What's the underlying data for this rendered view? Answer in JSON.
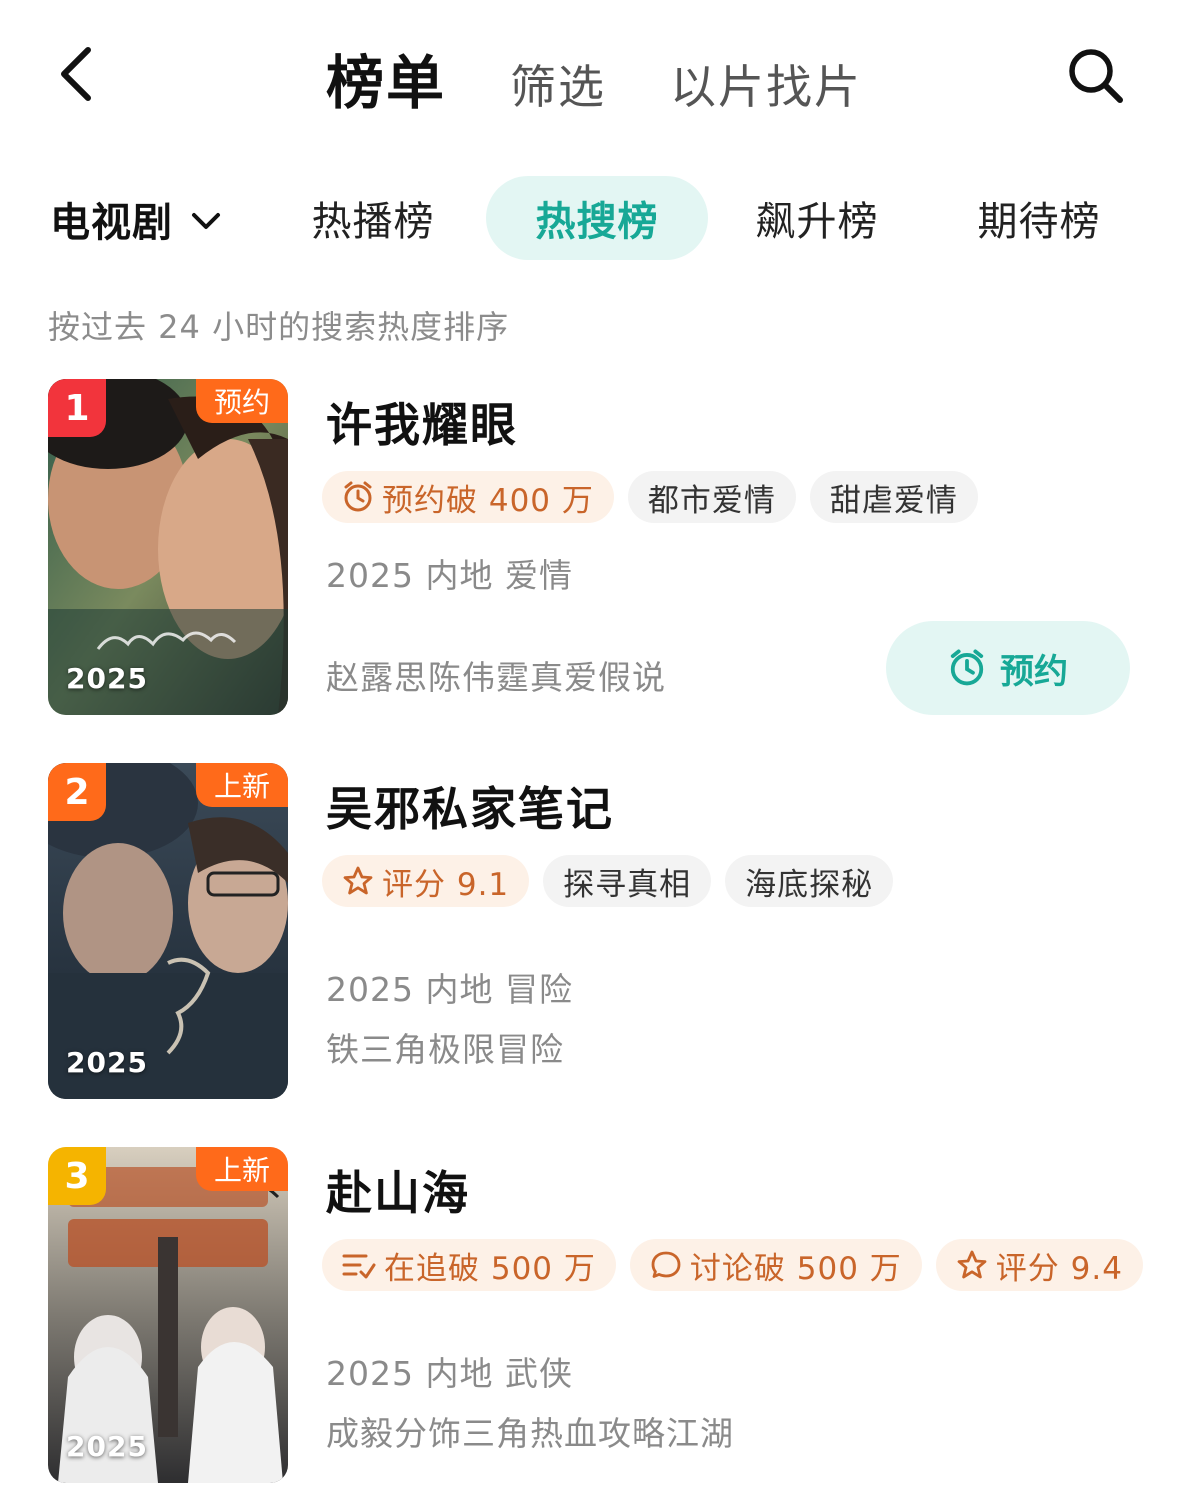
{
  "header": {
    "tabs": [
      {
        "label": "榜单"
      },
      {
        "label": "筛选"
      },
      {
        "label": "以片找片"
      }
    ]
  },
  "category": {
    "selected": "电视剧",
    "rank_tabs": [
      {
        "label": "热播榜"
      },
      {
        "label": "热搜榜"
      },
      {
        "label": "飙升榜"
      },
      {
        "label": "期待榜"
      }
    ]
  },
  "subtitle": "按过去 24 小时的搜索热度排序",
  "accent_color": "#17a896",
  "items": [
    {
      "rank": "1",
      "rank_color": "#f2343c",
      "status": "预约",
      "year": "2025",
      "title": "许我耀眼",
      "tags": [
        {
          "icon": "alarm-icon",
          "text": "预约破 400 万",
          "highlight": true
        },
        {
          "text": "都市爱情"
        },
        {
          "text": "甜虐爱情"
        }
      ],
      "info": "2025 内地 爱情",
      "desc": "赵露思陈伟霆真爱假说",
      "action": "预约"
    },
    {
      "rank": "2",
      "rank_color": "#ff6a1a",
      "status": "上新",
      "year": "2025",
      "title": "吴邪私家笔记",
      "tags": [
        {
          "icon": "star-icon",
          "text": "评分 9.1",
          "highlight": true
        },
        {
          "text": "探寻真相"
        },
        {
          "text": "海底探秘"
        }
      ],
      "info": "2025 内地 冒险",
      "desc": "铁三角极限冒险"
    },
    {
      "rank": "3",
      "rank_color": "#f5b400",
      "status": "上新",
      "year": "2025",
      "title": "赴山海",
      "tags": [
        {
          "icon": "list-check-icon",
          "text": "在追破 500 万",
          "highlight": true
        },
        {
          "icon": "comment-icon",
          "text": "讨论破 500 万",
          "highlight": true
        },
        {
          "icon": "star-icon",
          "text": "评分 9.4",
          "highlight": true
        }
      ],
      "info": "2025 内地 武侠",
      "desc": "成毅分饰三角热血攻略江湖"
    }
  ]
}
